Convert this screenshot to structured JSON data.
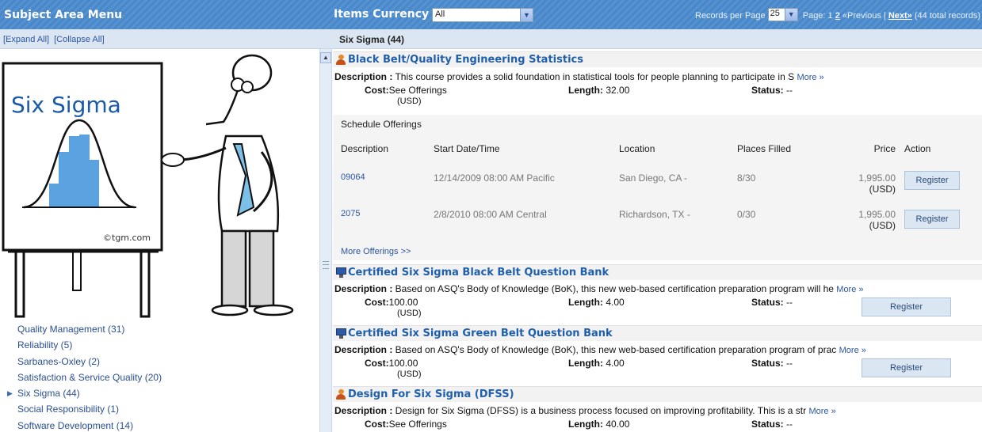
{
  "header": {
    "left_title": "Subject Area Menu",
    "currency_label": "Items Currency ID:",
    "currency_value": "All",
    "records_label": "Records per Page",
    "records_value": "25",
    "page_label": "Page:",
    "page_current": "1",
    "page_next_num": "2",
    "prev_label": "«Previous",
    "separator": "|",
    "next_label": "Next»",
    "total": "(44 total records)"
  },
  "subbar": {
    "expand": "[Expand All]",
    "collapse": "[Collapse All]",
    "crumb": "Six Sigma  (44)"
  },
  "illustration": {
    "board_title": "Six Sigma",
    "credit": "©tgm.com"
  },
  "subjects": [
    {
      "label": "Quality Management  (31)",
      "active": false
    },
    {
      "label": "Reliability  (5)",
      "active": false
    },
    {
      "label": "Sarbanes-Oxley  (2)",
      "active": false
    },
    {
      "label": "Satisfaction & Service Quality  (20)",
      "active": false
    },
    {
      "label": "Six Sigma  (44)",
      "active": true
    },
    {
      "label": "Social Responsibility  (1)",
      "active": false
    },
    {
      "label": "Software Development  (14)",
      "active": false
    }
  ],
  "labels": {
    "description": "Description :",
    "cost": "Cost:",
    "length": "Length:",
    "status": "Status:",
    "usd": "(USD)",
    "more": "More »",
    "register": "Register"
  },
  "courses": [
    {
      "title": "Black Belt/Quality Engineering Statistics",
      "icon": "person-icon",
      "description": " This course provides a solid foundation in statistical tools for people planning to participate in S",
      "cost": "See Offerings",
      "length": "32.00",
      "status": "--"
    },
    {
      "title": "Certified Six Sigma Black Belt Question Bank",
      "icon": "monitor-icon",
      "description": " Based on ASQ's Body of Knowledge (BoK), this new web-based certification preparation program will he",
      "cost": "100.00",
      "length": "4.00",
      "status": "--"
    },
    {
      "title": "Certified Six Sigma Green Belt Question Bank",
      "icon": "monitor-icon",
      "description": " Based on ASQ's Body of Knowledge (BoK), this new web-based certification preparation program of prac",
      "cost": "100.00",
      "length": "4.00",
      "status": "--"
    },
    {
      "title": "Design For Six Sigma (DFSS)",
      "icon": "person-icon",
      "description": " Design for Six Sigma (DFSS) is a business process focused on improving profitability. This is a str",
      "cost": "See Offerings",
      "length": "40.00",
      "status": "--"
    }
  ],
  "schedule": {
    "title": "Schedule Offerings",
    "headers": {
      "description": "Description",
      "start": "Start Date/Time",
      "location": "Location",
      "places": "Places Filled",
      "price": "Price",
      "action": "Action"
    },
    "rows": [
      {
        "code": "09064",
        "start": "12/14/2009 08:00 AM Pacific",
        "location": "San Diego, CA -",
        "places": "8/30",
        "price": "1,995.00"
      },
      {
        "code": "2075",
        "start": "2/8/2010 08:00 AM Central",
        "location": "Richardson, TX -",
        "places": "0/30",
        "price": "1,995.00"
      }
    ],
    "more_offerings": "More Offerings >>"
  }
}
